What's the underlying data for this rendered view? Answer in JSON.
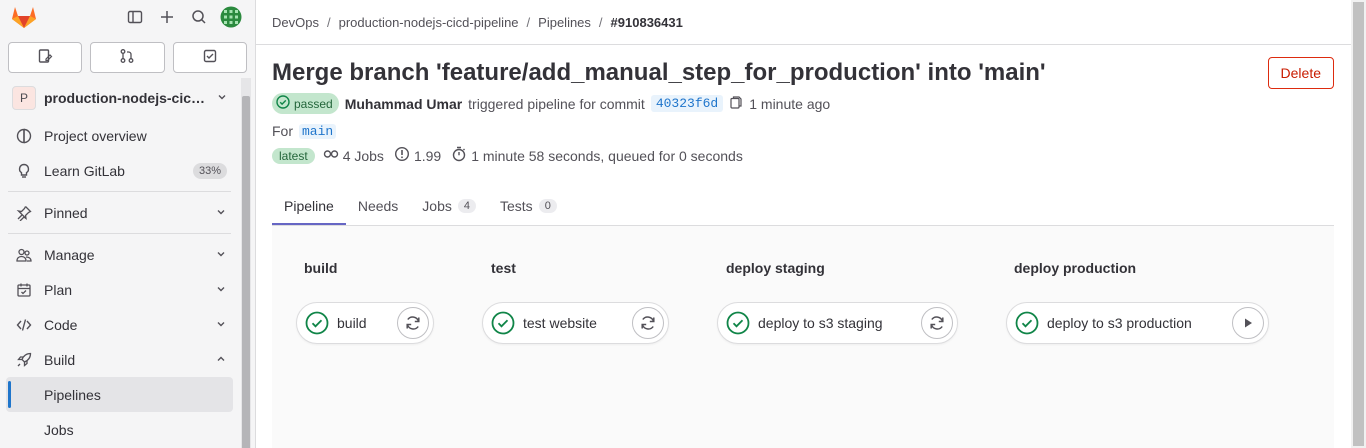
{
  "sidebar": {
    "project": {
      "avatar_letter": "P",
      "name": "production-nodejs-cicd-pipeline"
    },
    "items": [
      {
        "label": "Project overview",
        "icon": "project-icon"
      },
      {
        "label": "Learn GitLab",
        "icon": "bulb-icon",
        "badge": "33%"
      },
      {
        "label": "Pinned",
        "icon": "pin-icon"
      },
      {
        "label": "Manage",
        "icon": "users-icon"
      },
      {
        "label": "Plan",
        "icon": "planning-icon"
      },
      {
        "label": "Code",
        "icon": "code-icon"
      },
      {
        "label": "Build",
        "icon": "rocket-icon"
      },
      {
        "label": "Pipelines"
      },
      {
        "label": "Jobs"
      }
    ]
  },
  "breadcrumb": [
    "DevOps",
    "production-nodejs-cicd-pipeline",
    "Pipelines",
    "#910836431"
  ],
  "pipeline": {
    "title": "Merge branch 'feature/add_manual_step_for_production' into 'main'",
    "delete_label": "Delete",
    "status": "passed",
    "author": "Muhammad Umar",
    "triggered_text": "triggered pipeline for commit",
    "commit_sha": "40323f6d",
    "time_ago": "1 minute ago",
    "for_label": "For",
    "ref": "main",
    "latest_badge": "latest",
    "jobs_count": "4 Jobs",
    "compute": "1.99",
    "duration": "1 minute 58 seconds, queued for 0 seconds"
  },
  "tabs": [
    {
      "label": "Pipeline"
    },
    {
      "label": "Needs"
    },
    {
      "label": "Jobs",
      "count": "4"
    },
    {
      "label": "Tests",
      "count": "0"
    }
  ],
  "stages": [
    {
      "title": "build",
      "job": "build",
      "action": "retry-icon"
    },
    {
      "title": "test",
      "job": "test website",
      "action": "retry-icon"
    },
    {
      "title": "deploy staging",
      "job": "deploy to s3 staging",
      "action": "retry-icon"
    },
    {
      "title": "deploy production",
      "job": "deploy to s3 production",
      "action": "play-icon"
    }
  ],
  "colors": {
    "accent": "#1f75cb",
    "success": "#108548",
    "danger": "#dd2b0e",
    "tab_active": "#6666c4"
  }
}
